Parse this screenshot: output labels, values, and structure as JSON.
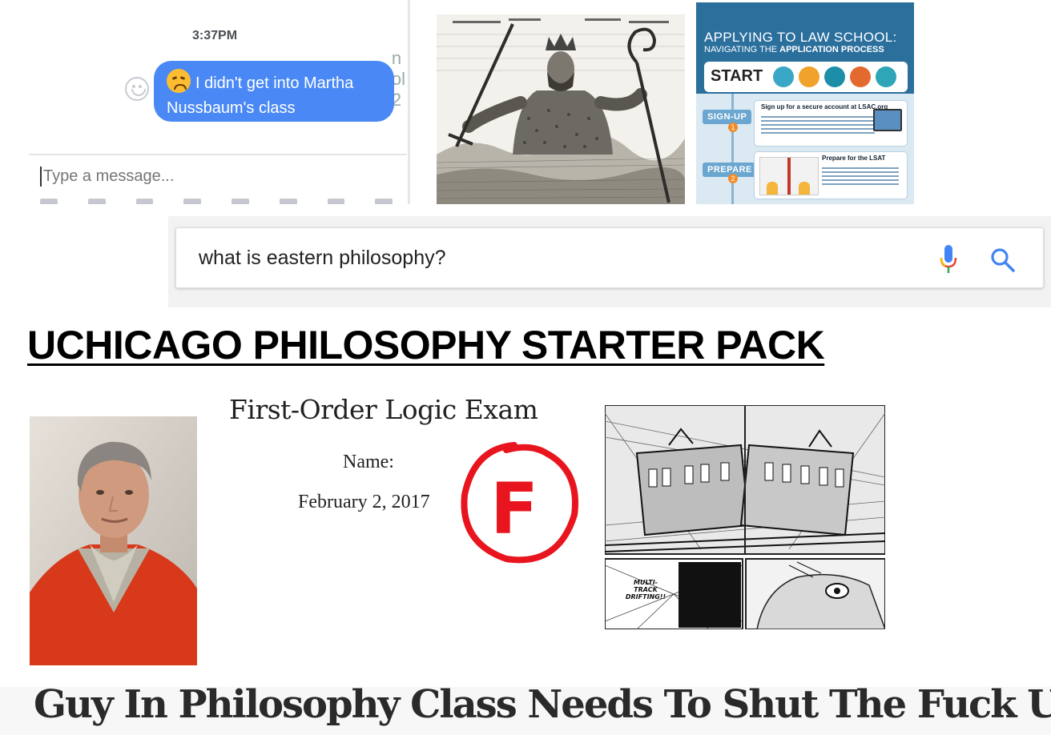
{
  "messenger": {
    "timestamp": "3:37PM",
    "message_text": "I didn't get into Martha Nussbaum's class",
    "input_placeholder": "Type a message...",
    "colors": {
      "bubble": "#4a89f5",
      "bubble_text": "#ffffff"
    }
  },
  "law_school_infographic": {
    "title_line1": "APPLYING TO LAW SCHOOL:",
    "title_line2_prefix": "NAVIGATING THE",
    "title_line2_bold": "APPLICATION PROCESS",
    "start_label": "START",
    "steps": [
      {
        "label": "SIGN-UP",
        "number": "1",
        "heading": "Sign up for a secure account at LSAC.org"
      },
      {
        "label": "PREPARE",
        "number": "2",
        "heading": "Prepare for the LSAT"
      }
    ]
  },
  "search": {
    "query": "what is eastern philosophy?",
    "icons": [
      "mic-icon",
      "search-icon"
    ]
  },
  "title": "UCHICAGO PHILOSOPHY STARTER PACK",
  "exam": {
    "title": "First-Order Logic Exam",
    "name_label": "Name:",
    "date": "February 2, 2017",
    "grade": "F"
  },
  "manga": {
    "caption": "MULTI-TRACK DRIFTING!!"
  },
  "headline": "Guy In Philosophy Class Needs To Shut The Fuck Up"
}
